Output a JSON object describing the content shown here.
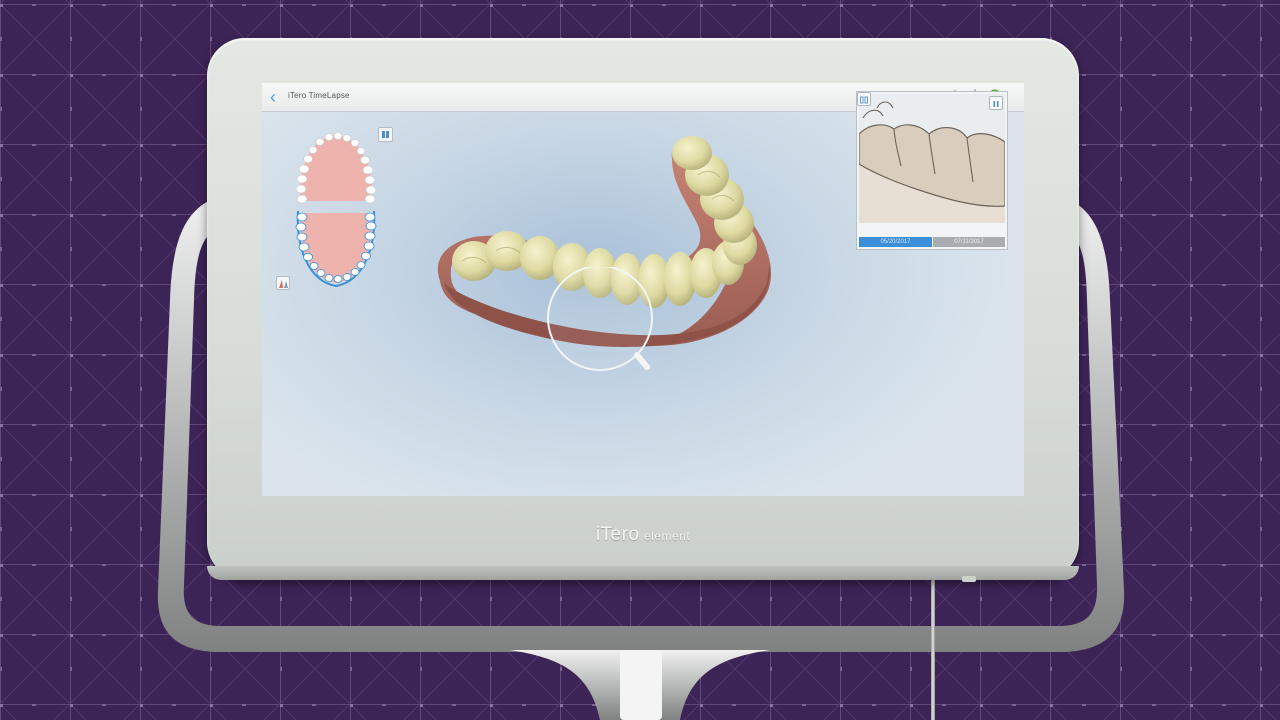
{
  "app": {
    "title": "iTero TimeLapse"
  },
  "device": {
    "brand_main": "iTero",
    "brand_sub": "element"
  },
  "toolbar": {
    "icons": [
      "battery-icon",
      "settings-gear-icon",
      "help-icon"
    ]
  },
  "timelapse": {
    "date_from": "05/20/2017",
    "date_to": "07/11/2017",
    "selected_segment": "date_from"
  },
  "colors": {
    "background": "#3d2457",
    "accent_blue": "#3b8ed8",
    "help_green": "#4caf3a",
    "selected_arch": "#3a8fd6"
  }
}
